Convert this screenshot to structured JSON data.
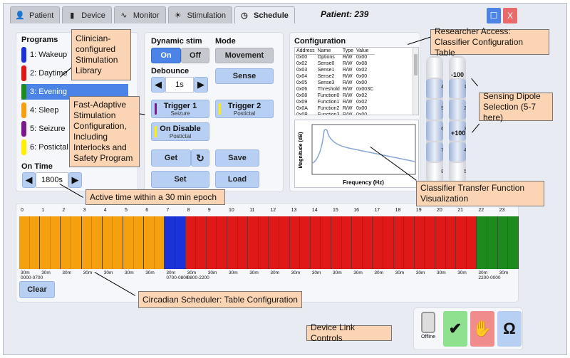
{
  "tabs": [
    {
      "label": "Patient",
      "icon": "person-icon"
    },
    {
      "label": "Device",
      "icon": "battery-icon"
    },
    {
      "label": "Monitor",
      "icon": "waveform-icon"
    },
    {
      "label": "Stimulation",
      "icon": "sun-icon"
    },
    {
      "label": "Schedule",
      "icon": "clock-icon",
      "active": true
    }
  ],
  "patient_label": "Patient: 239",
  "window_controls": {
    "restore": "☐",
    "close": "X"
  },
  "programs": {
    "title": "Programs",
    "items": [
      {
        "label": "1: Wakeup",
        "color": "#1a33d9"
      },
      {
        "label": "2: Daytime",
        "color": "#e01818"
      },
      {
        "label": "3: Evening",
        "color": "#1c8a1c",
        "selected": true
      },
      {
        "label": "4: Sleep",
        "color": "#f5a00f"
      },
      {
        "label": "5: Seizure",
        "color": "#7a1a8a"
      },
      {
        "label": "6: Postictal",
        "color": "#ffee00"
      }
    ]
  },
  "on_time": {
    "title": "On Time",
    "value": "1800s",
    "left": "◀",
    "right": "▶"
  },
  "dynamic_stim": {
    "title": "Dynamic stim",
    "on": "On",
    "off": "Off"
  },
  "mode": {
    "title": "Mode",
    "movement": "Movement",
    "sense": "Sense"
  },
  "debounce": {
    "title": "Debounce",
    "value": "1s",
    "left": "◀",
    "right": "▶"
  },
  "triggers": {
    "trigger1": {
      "title": "Trigger 1",
      "sub": "Seizure",
      "color": "#7a1a8a"
    },
    "trigger2": {
      "title": "Trigger 2",
      "sub": "Postictal",
      "color": "#ffee00"
    },
    "on_disable": {
      "title": "On Disable",
      "sub": "Postictal",
      "color": "#ffee00"
    }
  },
  "actions": {
    "get": "Get",
    "refresh": "↻",
    "save": "Save",
    "set": "Set",
    "load": "Load"
  },
  "configuration": {
    "title": "Configuration",
    "columns": [
      "Address",
      "Name",
      "Type",
      "Value"
    ],
    "rows": [
      [
        "0x00",
        "Options",
        "R/W",
        "0x00"
      ],
      [
        "0x02",
        "Sense0",
        "R/W",
        "0x08"
      ],
      [
        "0x03",
        "Sense1",
        "R/W",
        "0x02"
      ],
      [
        "0x04",
        "Sense2",
        "R/W",
        "0x00"
      ],
      [
        "0x05",
        "Sense3",
        "R/W",
        "0x00"
      ],
      [
        "0x06",
        "Threshold",
        "R/W",
        "0x003C"
      ],
      [
        "0x08",
        "Function0",
        "R/W",
        "0x02"
      ],
      [
        "0x09",
        "Function1",
        "R/W",
        "0x02"
      ],
      [
        "0x0A",
        "Function2",
        "R/W",
        "0x00"
      ],
      [
        "0x0B",
        "Function3",
        "R/W",
        "0x00"
      ]
    ]
  },
  "transfer_plot": {
    "xlabel": "Frequency (Hz)",
    "ylabel": "Magnitude (dB)"
  },
  "dipoles": {
    "left_numbers": [
      "4",
      "5",
      "6",
      "7",
      "8"
    ],
    "right_numbers": [
      "1",
      "2",
      "3",
      "4",
      "5"
    ],
    "minus": "-100",
    "plus": "+100"
  },
  "schedule": {
    "hours": [
      "0",
      "1",
      "2",
      "3",
      "4",
      "5",
      "6",
      "7",
      "8",
      "9",
      "10",
      "11",
      "12",
      "13",
      "14",
      "15",
      "16",
      "17",
      "18",
      "19",
      "20",
      "21",
      "22",
      "23"
    ],
    "blocks": [
      {
        "from": 0,
        "to": 7,
        "program": "Sleep",
        "color": "#f5a00f"
      },
      {
        "from": 7,
        "to": 8,
        "program": "Wakeup",
        "color": "#1a33d9"
      },
      {
        "from": 8,
        "to": 22,
        "program": "Daytime",
        "color": "#e01818"
      },
      {
        "from": 22,
        "to": 24,
        "program": "Evening",
        "color": "#1c8a1c"
      }
    ],
    "duration_label": "30m",
    "range_labels": [
      {
        "text": "0000-0700",
        "hour": 0
      },
      {
        "text": "0700-0800",
        "hour": 7
      },
      {
        "text": "0800-2200",
        "hour": 8
      },
      {
        "text": "2200-0000",
        "hour": 22
      }
    ],
    "clear": "Clear"
  },
  "device_link": {
    "offline": "Offline",
    "omega": "Ω"
  },
  "annotations": {
    "library": "Clinician-configured Stimulation Library",
    "fast_adaptive": "Fast-Adaptive Stimulation Configuration, Including Interlocks and Safety Program",
    "active_time": "Active time within a 30 min epoch",
    "researcher": "Researcher Access: Classifier Configuration Table",
    "dipole": "Sensing Dipole Selection (5-7 here)",
    "transfer": "Classifier Transfer Function Visualization",
    "circadian": "Circadian Scheduler: Table Configuration",
    "device_link": "Device Link Controls"
  }
}
